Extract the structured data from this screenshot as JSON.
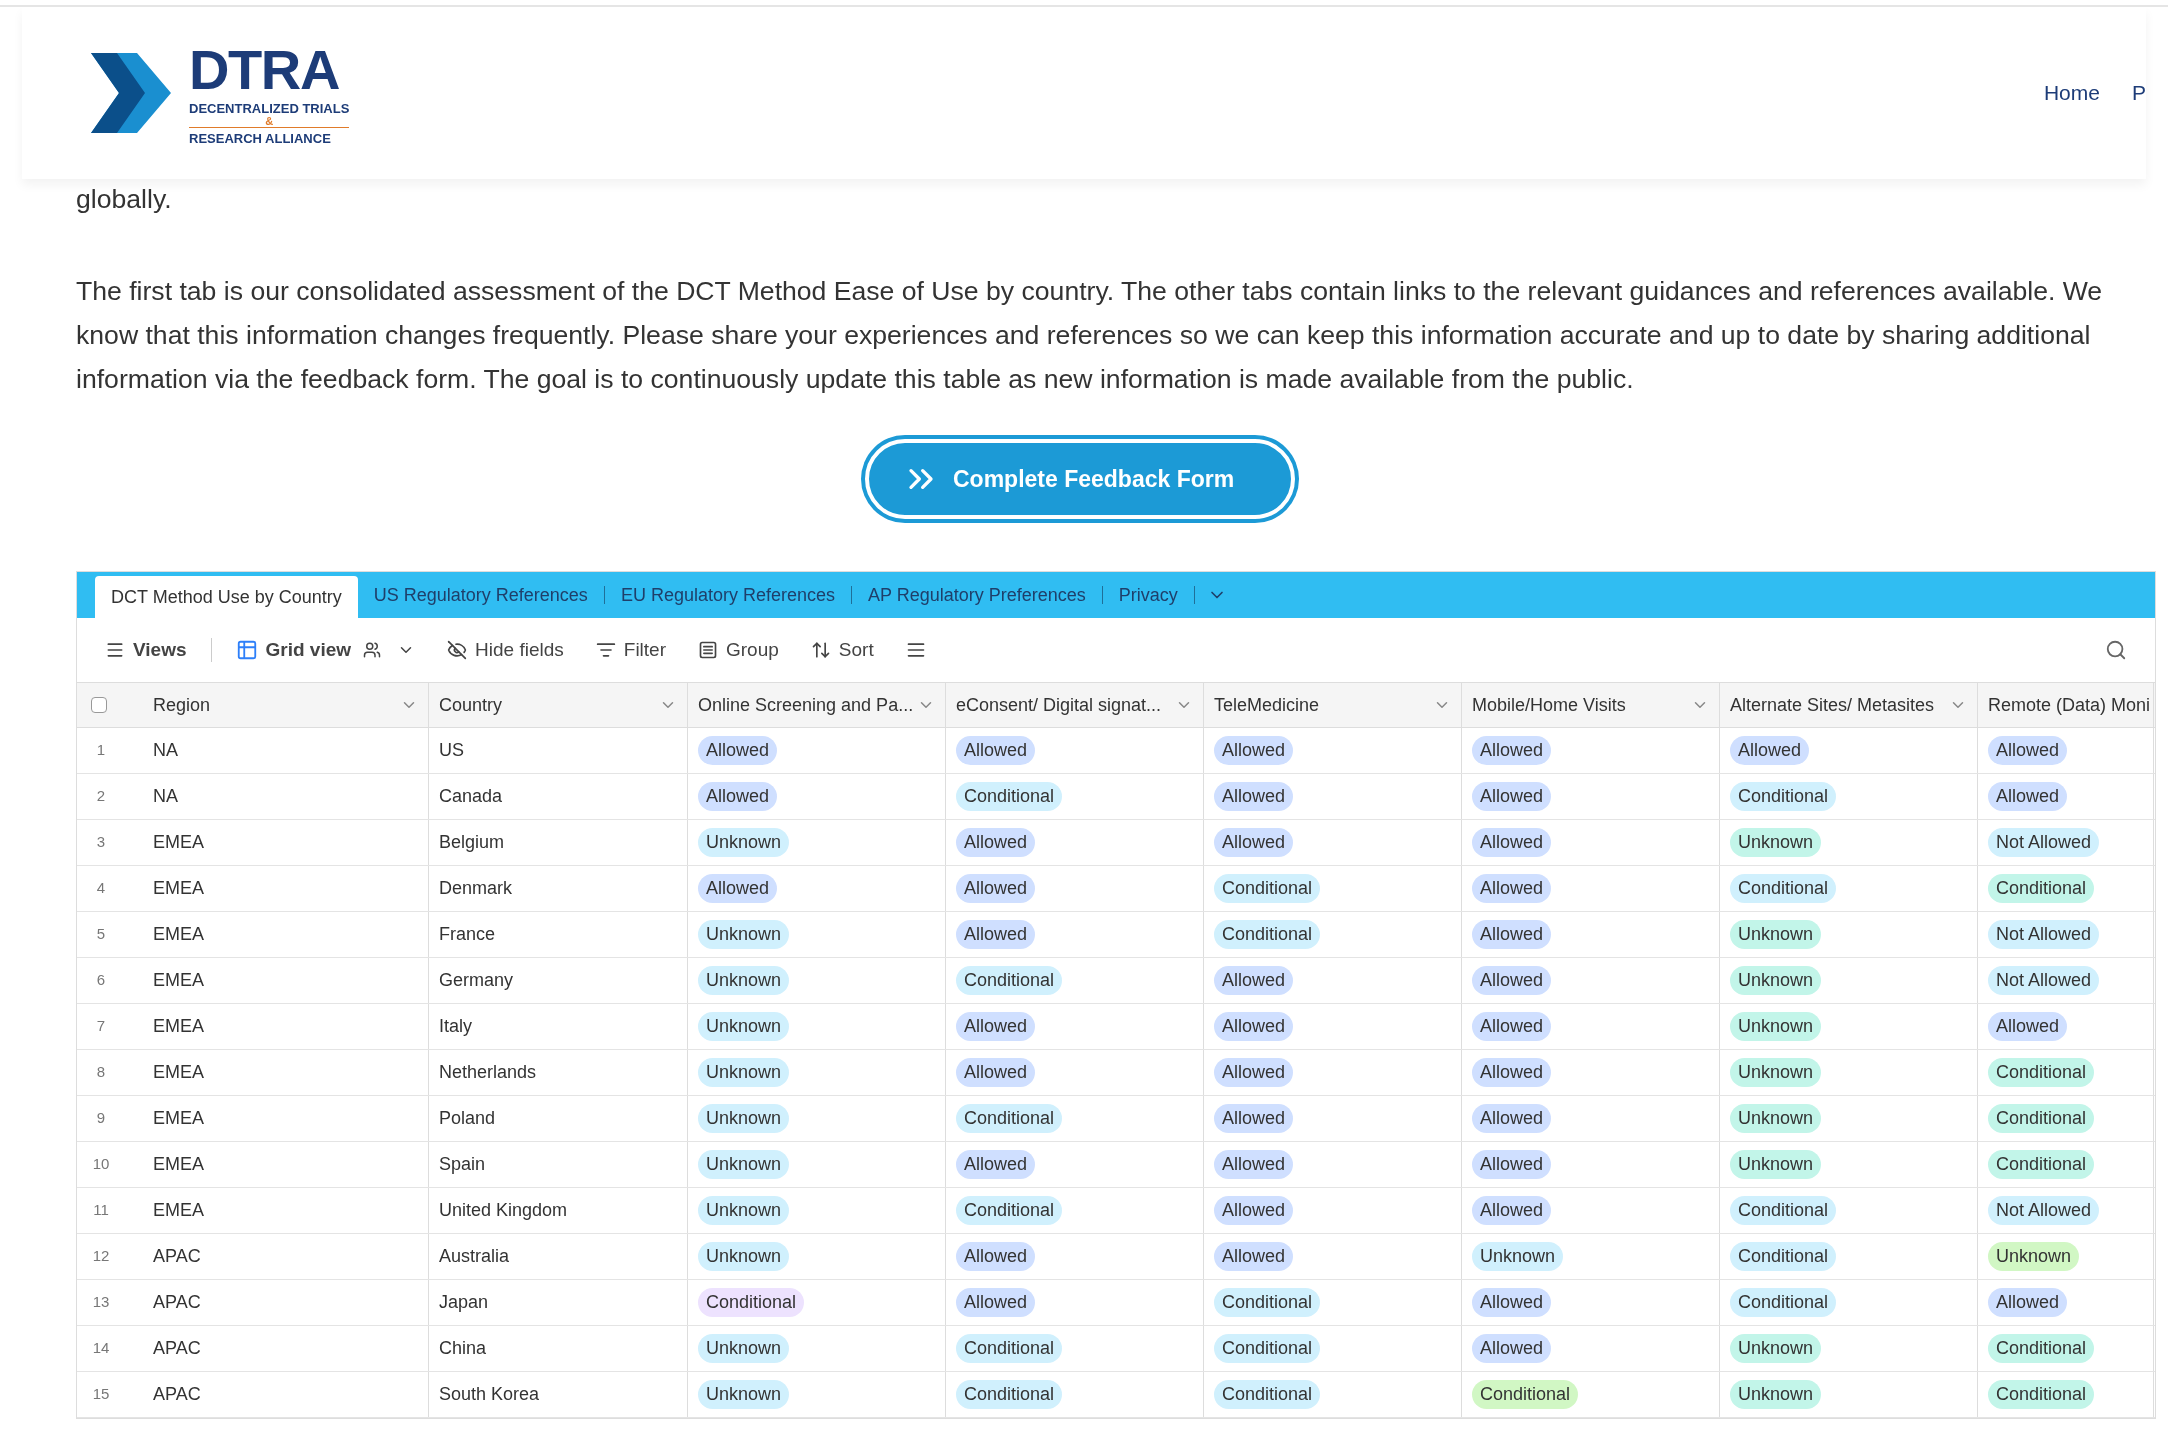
{
  "logo": {
    "name": "DTRA",
    "line_1": "DECENTRALIZED TRIALS",
    "ampersand": "&",
    "line_2": "RESEARCH ALLIANCE"
  },
  "nav": [
    "Home",
    "P"
  ],
  "intro": {
    "tail": "globally.",
    "paragraph": "The first tab is our consolidated assessment of the DCT Method Ease of Use by country. The other tabs contain links to the relevant guidances and references available. We know that this information changes frequently. Please share your experiences and references so we can keep this information accurate and up to date by sharing additional information via the feedback form. The goal is to continuously update this table as new information is made available from the public."
  },
  "feedback_button": "Complete Feedback Form",
  "tabs": [
    {
      "label": "DCT Method Use by Country",
      "selected": true
    },
    {
      "label": "US Regulatory References",
      "selected": false
    },
    {
      "label": "EU Regulatory References",
      "selected": false
    },
    {
      "label": "AP Regulatory Preferences",
      "selected": false
    },
    {
      "label": "Privacy",
      "selected": false
    }
  ],
  "toolbar": {
    "views": "Views",
    "grid_view": "Grid view",
    "hide_fields": "Hide fields",
    "filter": "Filter",
    "group": "Group",
    "sort": "Sort"
  },
  "table": {
    "row_numbers": [
      "1",
      "2",
      "3",
      "4",
      "5",
      "6",
      "7",
      "8",
      "9",
      "10",
      "11",
      "12",
      "13",
      "14",
      "15"
    ],
    "select_all_checked": false,
    "columns": [
      "Region",
      "Country",
      "Online Screening and Pa...",
      "eConsent/ Digital signat...",
      "TeleMedicine",
      "Mobile/Home Visits",
      "Alternate Sites/ Metasites",
      "Remote (Data) Moni"
    ],
    "rows": [
      {
        "cells": [
          {
            "kind": "text",
            "text": "NA"
          },
          {
            "kind": "text",
            "text": "US"
          },
          {
            "kind": "tag",
            "text": "Allowed",
            "color": "#cfdfff"
          },
          {
            "kind": "tag",
            "text": "Allowed",
            "color": "#cfdfff"
          },
          {
            "kind": "tag",
            "text": "Allowed",
            "color": "#cfdfff"
          },
          {
            "kind": "tag",
            "text": "Allowed",
            "color": "#cfdfff"
          },
          {
            "kind": "tag",
            "text": "Allowed",
            "color": "#cfdfff"
          },
          {
            "kind": "tag",
            "text": "Allowed",
            "color": "#cfdfff"
          }
        ]
      },
      {
        "cells": [
          {
            "kind": "text",
            "text": "NA"
          },
          {
            "kind": "text",
            "text": "Canada"
          },
          {
            "kind": "tag",
            "text": "Allowed",
            "color": "#cfdfff"
          },
          {
            "kind": "tag",
            "text": "Conditional",
            "color": "#d0f0fd"
          },
          {
            "kind": "tag",
            "text": "Allowed",
            "color": "#cfdfff"
          },
          {
            "kind": "tag",
            "text": "Allowed",
            "color": "#cfdfff"
          },
          {
            "kind": "tag",
            "text": "Conditional",
            "color": "#d0f0fd"
          },
          {
            "kind": "tag",
            "text": "Allowed",
            "color": "#cfdfff"
          }
        ]
      },
      {
        "cells": [
          {
            "kind": "text",
            "text": "EMEA"
          },
          {
            "kind": "text",
            "text": "Belgium"
          },
          {
            "kind": "tag",
            "text": "Unknown",
            "color": "#d0f0fd"
          },
          {
            "kind": "tag",
            "text": "Allowed",
            "color": "#cfdfff"
          },
          {
            "kind": "tag",
            "text": "Allowed",
            "color": "#cfdfff"
          },
          {
            "kind": "tag",
            "text": "Allowed",
            "color": "#cfdfff"
          },
          {
            "kind": "tag",
            "text": "Unknown",
            "color": "#c2f5e9"
          },
          {
            "kind": "tag",
            "text": "Not Allowed",
            "color": "#d0f0fd"
          }
        ]
      },
      {
        "cells": [
          {
            "kind": "text",
            "text": "EMEA"
          },
          {
            "kind": "text",
            "text": "Denmark"
          },
          {
            "kind": "tag",
            "text": "Allowed",
            "color": "#cfdfff"
          },
          {
            "kind": "tag",
            "text": "Allowed",
            "color": "#cfdfff"
          },
          {
            "kind": "tag",
            "text": "Conditional",
            "color": "#d0f0fd"
          },
          {
            "kind": "tag",
            "text": "Allowed",
            "color": "#cfdfff"
          },
          {
            "kind": "tag",
            "text": "Conditional",
            "color": "#d0f0fd"
          },
          {
            "kind": "tag",
            "text": "Conditional",
            "color": "#c2f5e9"
          }
        ]
      },
      {
        "cells": [
          {
            "kind": "text",
            "text": "EMEA"
          },
          {
            "kind": "text",
            "text": "France"
          },
          {
            "kind": "tag",
            "text": "Unknown",
            "color": "#d0f0fd"
          },
          {
            "kind": "tag",
            "text": "Allowed",
            "color": "#cfdfff"
          },
          {
            "kind": "tag",
            "text": "Conditional",
            "color": "#d0f0fd"
          },
          {
            "kind": "tag",
            "text": "Allowed",
            "color": "#cfdfff"
          },
          {
            "kind": "tag",
            "text": "Unknown",
            "color": "#c2f5e9"
          },
          {
            "kind": "tag",
            "text": "Not Allowed",
            "color": "#d0f0fd"
          }
        ]
      },
      {
        "cells": [
          {
            "kind": "text",
            "text": "EMEA"
          },
          {
            "kind": "text",
            "text": "Germany"
          },
          {
            "kind": "tag",
            "text": "Unknown",
            "color": "#d0f0fd"
          },
          {
            "kind": "tag",
            "text": "Conditional",
            "color": "#d0f0fd"
          },
          {
            "kind": "tag",
            "text": "Allowed",
            "color": "#cfdfff"
          },
          {
            "kind": "tag",
            "text": "Allowed",
            "color": "#cfdfff"
          },
          {
            "kind": "tag",
            "text": "Unknown",
            "color": "#c2f5e9"
          },
          {
            "kind": "tag",
            "text": "Not Allowed",
            "color": "#d0f0fd"
          }
        ]
      },
      {
        "cells": [
          {
            "kind": "text",
            "text": "EMEA"
          },
          {
            "kind": "text",
            "text": "Italy"
          },
          {
            "kind": "tag",
            "text": "Unknown",
            "color": "#d0f0fd"
          },
          {
            "kind": "tag",
            "text": "Allowed",
            "color": "#cfdfff"
          },
          {
            "kind": "tag",
            "text": "Allowed",
            "color": "#cfdfff"
          },
          {
            "kind": "tag",
            "text": "Allowed",
            "color": "#cfdfff"
          },
          {
            "kind": "tag",
            "text": "Unknown",
            "color": "#c2f5e9"
          },
          {
            "kind": "tag",
            "text": "Allowed",
            "color": "#cfdfff"
          }
        ]
      },
      {
        "cells": [
          {
            "kind": "text",
            "text": "EMEA"
          },
          {
            "kind": "text",
            "text": "Netherlands"
          },
          {
            "kind": "tag",
            "text": "Unknown",
            "color": "#d0f0fd"
          },
          {
            "kind": "tag",
            "text": "Allowed",
            "color": "#cfdfff"
          },
          {
            "kind": "tag",
            "text": "Allowed",
            "color": "#cfdfff"
          },
          {
            "kind": "tag",
            "text": "Allowed",
            "color": "#cfdfff"
          },
          {
            "kind": "tag",
            "text": "Unknown",
            "color": "#c2f5e9"
          },
          {
            "kind": "tag",
            "text": "Conditional",
            "color": "#c2f5e9"
          }
        ]
      },
      {
        "cells": [
          {
            "kind": "text",
            "text": "EMEA"
          },
          {
            "kind": "text",
            "text": "Poland"
          },
          {
            "kind": "tag",
            "text": "Unknown",
            "color": "#d0f0fd"
          },
          {
            "kind": "tag",
            "text": "Conditional",
            "color": "#d0f0fd"
          },
          {
            "kind": "tag",
            "text": "Allowed",
            "color": "#cfdfff"
          },
          {
            "kind": "tag",
            "text": "Allowed",
            "color": "#cfdfff"
          },
          {
            "kind": "tag",
            "text": "Unknown",
            "color": "#c2f5e9"
          },
          {
            "kind": "tag",
            "text": "Conditional",
            "color": "#c2f5e9"
          }
        ]
      },
      {
        "cells": [
          {
            "kind": "text",
            "text": "EMEA"
          },
          {
            "kind": "text",
            "text": "Spain"
          },
          {
            "kind": "tag",
            "text": "Unknown",
            "color": "#d0f0fd"
          },
          {
            "kind": "tag",
            "text": "Allowed",
            "color": "#cfdfff"
          },
          {
            "kind": "tag",
            "text": "Allowed",
            "color": "#cfdfff"
          },
          {
            "kind": "tag",
            "text": "Allowed",
            "color": "#cfdfff"
          },
          {
            "kind": "tag",
            "text": "Unknown",
            "color": "#c2f5e9"
          },
          {
            "kind": "tag",
            "text": "Conditional",
            "color": "#c2f5e9"
          }
        ]
      },
      {
        "cells": [
          {
            "kind": "text",
            "text": "EMEA"
          },
          {
            "kind": "text",
            "text": "United Kingdom"
          },
          {
            "kind": "tag",
            "text": "Unknown",
            "color": "#d0f0fd"
          },
          {
            "kind": "tag",
            "text": "Conditional",
            "color": "#d0f0fd"
          },
          {
            "kind": "tag",
            "text": "Allowed",
            "color": "#cfdfff"
          },
          {
            "kind": "tag",
            "text": "Allowed",
            "color": "#cfdfff"
          },
          {
            "kind": "tag",
            "text": "Conditional",
            "color": "#d0f0fd"
          },
          {
            "kind": "tag",
            "text": "Not Allowed",
            "color": "#d0f0fd"
          }
        ]
      },
      {
        "cells": [
          {
            "kind": "text",
            "text": "APAC"
          },
          {
            "kind": "text",
            "text": "Australia"
          },
          {
            "kind": "tag",
            "text": "Unknown",
            "color": "#d0f0fd"
          },
          {
            "kind": "tag",
            "text": "Allowed",
            "color": "#cfdfff"
          },
          {
            "kind": "tag",
            "text": "Allowed",
            "color": "#cfdfff"
          },
          {
            "kind": "tag",
            "text": "Unknown",
            "color": "#d0f0fd"
          },
          {
            "kind": "tag",
            "text": "Conditional",
            "color": "#d0f0fd"
          },
          {
            "kind": "tag",
            "text": "Unknown",
            "color": "#d1f7c4"
          }
        ]
      },
      {
        "cells": [
          {
            "kind": "text",
            "text": "APAC"
          },
          {
            "kind": "text",
            "text": "Japan"
          },
          {
            "kind": "tag",
            "text": "Conditional",
            "color": "#ede2fe"
          },
          {
            "kind": "tag",
            "text": "Allowed",
            "color": "#cfdfff"
          },
          {
            "kind": "tag",
            "text": "Conditional",
            "color": "#d0f0fd"
          },
          {
            "kind": "tag",
            "text": "Allowed",
            "color": "#cfdfff"
          },
          {
            "kind": "tag",
            "text": "Conditional",
            "color": "#d0f0fd"
          },
          {
            "kind": "tag",
            "text": "Allowed",
            "color": "#cfdfff"
          }
        ]
      },
      {
        "cells": [
          {
            "kind": "text",
            "text": "APAC"
          },
          {
            "kind": "text",
            "text": "China"
          },
          {
            "kind": "tag",
            "text": "Unknown",
            "color": "#d0f0fd"
          },
          {
            "kind": "tag",
            "text": "Conditional",
            "color": "#d0f0fd"
          },
          {
            "kind": "tag",
            "text": "Conditional",
            "color": "#d0f0fd"
          },
          {
            "kind": "tag",
            "text": "Allowed",
            "color": "#cfdfff"
          },
          {
            "kind": "tag",
            "text": "Unknown",
            "color": "#c2f5e9"
          },
          {
            "kind": "tag",
            "text": "Conditional",
            "color": "#c2f5e9"
          }
        ]
      },
      {
        "cells": [
          {
            "kind": "text",
            "text": "APAC"
          },
          {
            "kind": "text",
            "text": "South Korea"
          },
          {
            "kind": "tag",
            "text": "Unknown",
            "color": "#d0f0fd"
          },
          {
            "kind": "tag",
            "text": "Conditional",
            "color": "#d0f0fd"
          },
          {
            "kind": "tag",
            "text": "Conditional",
            "color": "#d0f0fd"
          },
          {
            "kind": "tag",
            "text": "Conditional",
            "color": "#d1f7c4"
          },
          {
            "kind": "tag",
            "text": "Unknown",
            "color": "#c2f5e9"
          },
          {
            "kind": "tag",
            "text": "Conditional",
            "color": "#c2f5e9"
          }
        ]
      }
    ]
  }
}
